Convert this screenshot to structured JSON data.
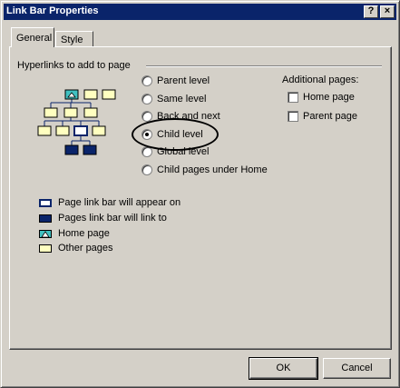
{
  "window": {
    "title": "Link Bar Properties",
    "help_glyph": "?",
    "close_glyph": "×"
  },
  "tabs": [
    {
      "label": "General",
      "selected": true
    },
    {
      "label": "Style",
      "selected": false
    }
  ],
  "general": {
    "section_label": "Hyperlinks to add to page",
    "radio_options": [
      {
        "label": "Parent level",
        "checked": false
      },
      {
        "label": "Same level",
        "checked": false
      },
      {
        "label": "Back and next",
        "checked": false
      },
      {
        "label": "Child level",
        "checked": true
      },
      {
        "label": "Global level",
        "checked": false
      },
      {
        "label": "Child pages under Home",
        "checked": false
      }
    ],
    "additional_pages_label": "Additional pages:",
    "checkboxes": [
      {
        "label": "Home page",
        "checked": false
      },
      {
        "label": "Parent page",
        "checked": false
      }
    ],
    "legend": [
      {
        "label": "Page link bar will appear on",
        "swatch": "outline-navy"
      },
      {
        "label": "Pages link bar will link to",
        "swatch": "solid-navy"
      },
      {
        "label": "Home page",
        "swatch": "home-teal"
      },
      {
        "label": "Other pages",
        "swatch": "cream"
      }
    ]
  },
  "buttons": {
    "ok": "OK",
    "cancel": "Cancel"
  },
  "colors": {
    "title_bar": "#0a246a",
    "dialog_face": "#d4d0c8",
    "navy": "#0a246a",
    "cream": "#ffffc0",
    "home_teal": "#40c0c0"
  }
}
